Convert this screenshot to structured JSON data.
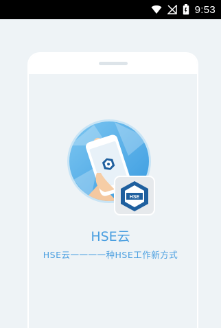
{
  "status_bar": {
    "time": "9:53",
    "icons": [
      "wifi-icon",
      "no-signal-icon",
      "battery-icon"
    ]
  },
  "splash": {
    "app_name": "HSE云",
    "slogan": "HSE云一一一一种HSE工作新方式",
    "badge_text": "HSE"
  },
  "colors": {
    "background": "#eef3f6",
    "accent": "#4b9fe0",
    "badge": "#1f5f9e"
  }
}
